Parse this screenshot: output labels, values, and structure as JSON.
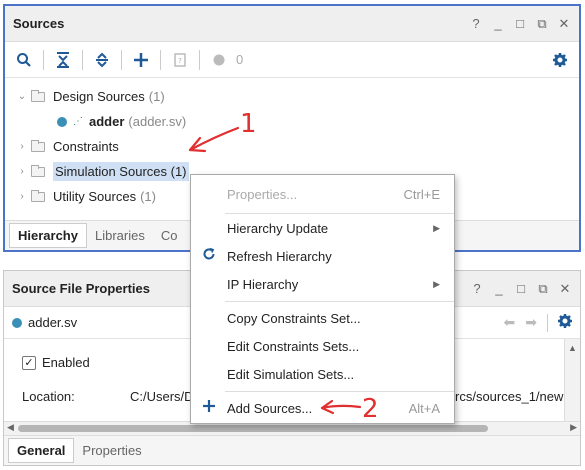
{
  "sources_panel": {
    "title": "Sources",
    "window_controls": [
      "?",
      "_",
      "□",
      "⧉",
      "✕"
    ],
    "toolbar": {
      "count": "0",
      "icons": [
        "search-icon",
        "collapse-all-icon",
        "expand-all-icon",
        "add-icon",
        "file-icon",
        "status-dot-icon",
        "gear-icon"
      ]
    },
    "tree": {
      "design_sources": {
        "label": "Design Sources",
        "count": "(1)"
      },
      "adder": {
        "label": "adder",
        "file": "(adder.sv)"
      },
      "constraints": {
        "label": "Constraints"
      },
      "simulation_sources": {
        "label": "Simulation Sources",
        "count": "(1)"
      },
      "utility_sources": {
        "label": "Utility Sources",
        "count": "(1)"
      }
    },
    "tabs": [
      "Hierarchy",
      "Libraries",
      "Co"
    ]
  },
  "source_file_properties": {
    "title": "Source File Properties",
    "window_controls": [
      "?",
      "_",
      "□",
      "⧉",
      "✕"
    ],
    "file_name": "adder.sv",
    "enabled_label": "Enabled",
    "enabled_checked": true,
    "location_label": "Location:",
    "location_value_left": "C:/Users/D",
    "location_value_right": "rcs/sources_1/new",
    "tabs": [
      "General",
      "Properties"
    ]
  },
  "context_menu": {
    "items": [
      {
        "label": "Properties...",
        "shortcut": "Ctrl+E",
        "disabled": true
      },
      {
        "label": "Hierarchy Update",
        "submenu": true
      },
      {
        "label": "Refresh Hierarchy",
        "icon": "refresh-icon"
      },
      {
        "label": "IP Hierarchy",
        "submenu": true
      },
      {
        "label": "Copy Constraints Set..."
      },
      {
        "label": "Edit Constraints Sets..."
      },
      {
        "label": "Edit Simulation Sets..."
      },
      {
        "label": "Add Sources...",
        "shortcut": "Alt+A",
        "icon": "plus-icon"
      }
    ]
  },
  "annotations": {
    "number_1": "1",
    "number_2": "2",
    "color": "#e03030"
  },
  "colors": {
    "selection": "#cfe0f5",
    "accent_blue": "#1f5a96",
    "panel_border_active": "#4a73c9"
  }
}
